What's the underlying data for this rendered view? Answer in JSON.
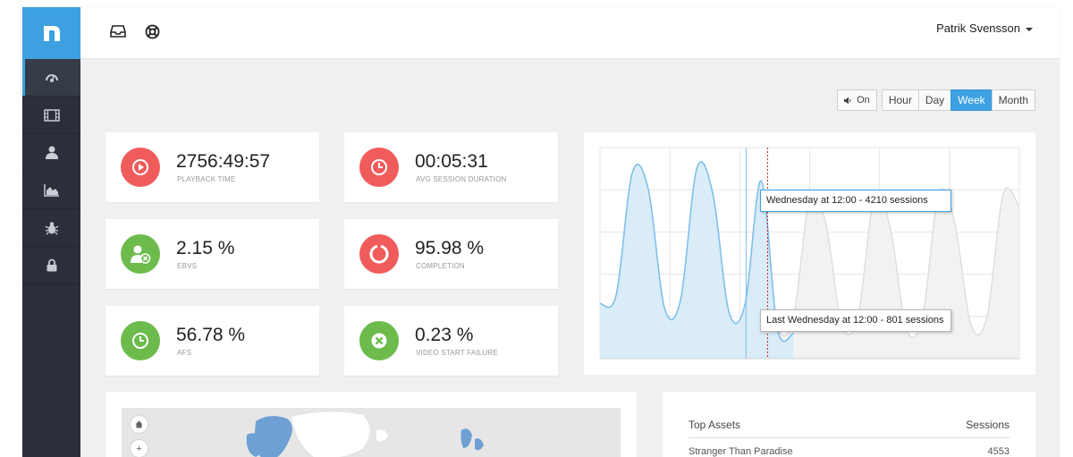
{
  "app": {
    "logo_letter": "n"
  },
  "sidebar": {
    "items": [
      {
        "icon": "dashboard-icon",
        "active": true
      },
      {
        "icon": "film-icon",
        "active": false
      },
      {
        "icon": "user-icon",
        "active": false
      },
      {
        "icon": "area-chart-icon",
        "active": false
      },
      {
        "icon": "bug-icon",
        "active": false
      },
      {
        "icon": "lock-icon",
        "active": false
      }
    ]
  },
  "topbar": {
    "icons": [
      "inbox-icon",
      "lifebuoy-icon"
    ],
    "user_name": "Patrik Svensson"
  },
  "toolbar": {
    "sound_label": "On",
    "ranges": [
      "Hour",
      "Day",
      "Week",
      "Month"
    ],
    "active_range": "Week"
  },
  "kpis": [
    {
      "value": "2756:49:57",
      "label": "PLAYBACK TIME",
      "color": "#f05c5c",
      "icon": "play-icon"
    },
    {
      "value": "00:05:31",
      "label": "AVG SESSION DURATION",
      "color": "#f05c5c",
      "icon": "clock-icon"
    },
    {
      "value": "2.15 %",
      "label": "EBVS",
      "color": "#6dbb4c",
      "icon": "user-cancel-icon"
    },
    {
      "value": "95.98 %",
      "label": "COMPLETION",
      "color": "#f05c5c",
      "icon": "circle-notch-icon"
    },
    {
      "value": "56.78 %",
      "label": "AFS",
      "color": "#6dbb4c",
      "icon": "clock-icon"
    },
    {
      "value": "0.23 %",
      "label": "VIDEO START FAILURE",
      "color": "#6dbb4c",
      "icon": "x-circle-icon"
    }
  ],
  "chart": {
    "tooltip_current": "Wednesday at 12:00 - 4210 sessions",
    "tooltip_last": "Last Wednesday at 12:00 - 801 sessions"
  },
  "chart_data": {
    "type": "area",
    "series": [
      {
        "values": [
          1300,
          1500,
          4400,
          4000,
          1200,
          1400,
          4500,
          3900,
          1100,
          1300,
          4210,
          700,
          600
        ]
      },
      {
        "values": [
          900,
          1100,
          3800,
          3400,
          900,
          1000,
          3900,
          3300,
          800,
          1000,
          3700,
          801,
          1000,
          3800,
          3200,
          800,
          1000,
          3800,
          3100,
          700,
          1000,
          3900,
          3200,
          800,
          1000,
          3900,
          3600
        ]
      }
    ],
    "ylim": [
      0,
      5000
    ],
    "grid": true,
    "colors": {
      "current": "#7fbfe8",
      "current_fill": "#d6ebf8",
      "last": "#dddddd",
      "last_fill": "#f2f2f2",
      "marker": "#cc2222"
    }
  },
  "map": {
    "controls": [
      "home-icon",
      "zoom-in-icon"
    ],
    "zoom_in_label": "+"
  },
  "assets": {
    "header": {
      "left": "Top Assets",
      "right": "Sessions"
    },
    "rows": [
      {
        "name": "Stranger Than Paradise",
        "sessions": "4553"
      }
    ]
  }
}
